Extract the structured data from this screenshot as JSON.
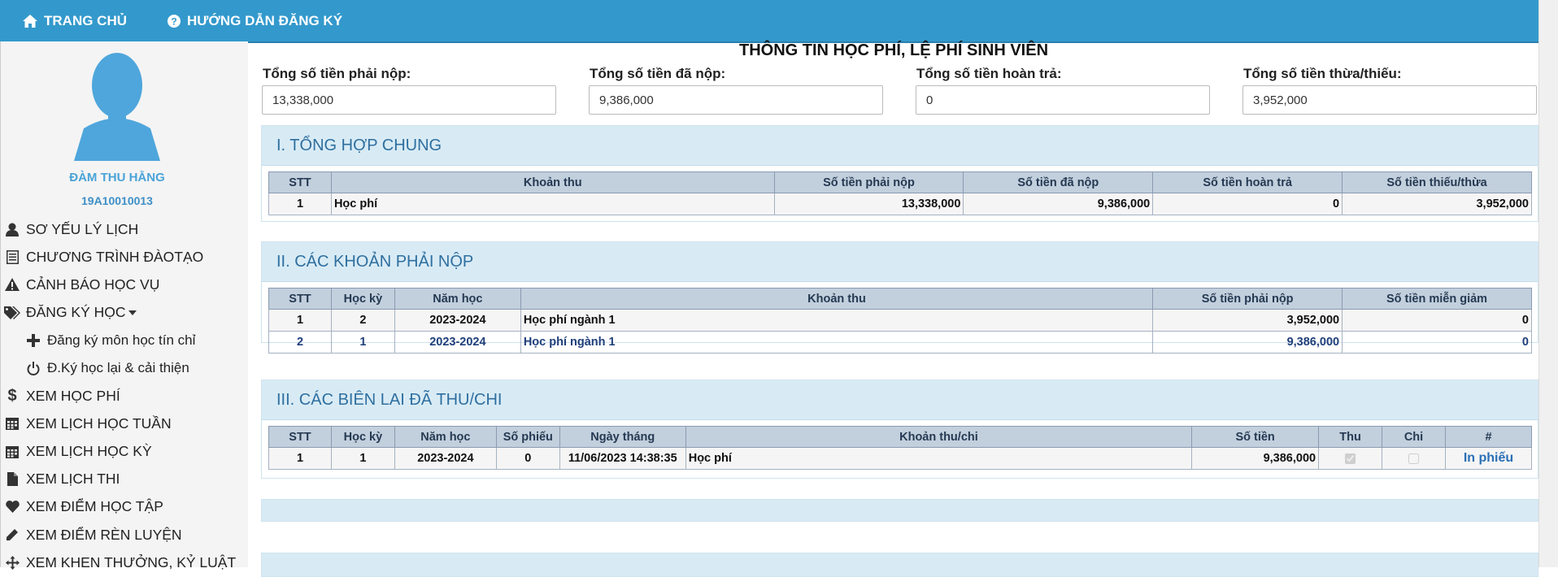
{
  "topnav": {
    "home": "TRANG CHỦ",
    "guide": "HƯỚNG DẪN ĐĂNG KÝ"
  },
  "user": {
    "name": "ĐÀM THU HẰNG",
    "id": "19A10010013"
  },
  "menu": [
    {
      "label": "SƠ YẾU LÝ LỊCH",
      "icon": "user-icon"
    },
    {
      "label": "CHƯƠNG TRÌNH ĐÀOTẠO",
      "icon": "list-icon"
    },
    {
      "label": "CẢNH BÁO HỌC VỤ",
      "icon": "warning-icon"
    },
    {
      "label": "ĐĂNG KÝ HỌC",
      "icon": "tags-icon"
    },
    {
      "label": "Đăng ký môn học tín chỉ",
      "icon": "plus-icon"
    },
    {
      "label": "Đ.Ký học lại & cải thiện",
      "icon": "power-icon"
    },
    {
      "label": "XEM HỌC PHÍ",
      "icon": "dollar-icon"
    },
    {
      "label": "XEM LỊCH HỌC TUẦN",
      "icon": "calendar-icon"
    },
    {
      "label": "XEM LỊCH HỌC KỲ",
      "icon": "calendar-icon"
    },
    {
      "label": "XEM LỊCH THI",
      "icon": "file-icon"
    },
    {
      "label": "XEM ĐIỂM HỌC TẬP",
      "icon": "heart-icon"
    },
    {
      "label": "XEM ĐIỂM RÈN LUYỆN",
      "icon": "pencil-icon"
    },
    {
      "label": "XEM KHEN THƯỞNG, KỶ LUẬT",
      "icon": "move-icon"
    }
  ],
  "page_title": "THÔNG TIN HỌC PHÍ, LỆ PHÍ SINH VIÊN",
  "summary": {
    "due_label": "Tổng số tiền phải nộp:",
    "due_value": "13,338,000",
    "paid_label": "Tổng số tiền đã nộp:",
    "paid_value": "9,386,000",
    "refund_label": "Tổng số tiền hoàn trả:",
    "refund_value": "0",
    "diff_label": "Tổng số tiền thừa/thiếu:",
    "diff_value": "3,952,000"
  },
  "section1": {
    "title": "I. TỔNG HỢP CHUNG",
    "headers": [
      "STT",
      "Khoản thu",
      "Số tiền phải nộp",
      "Số tiền đã nộp",
      "Số tiền hoàn trả",
      "Số tiền thiếu/thừa"
    ],
    "rows": [
      [
        "1",
        "Học phí",
        "13,338,000",
        "9,386,000",
        "0",
        "3,952,000"
      ]
    ]
  },
  "section2": {
    "title": "II. CÁC KHOẢN PHẢI NỘP",
    "headers": [
      "STT",
      "Học kỳ",
      "Năm học",
      "Khoản thu",
      "Số tiền phải nộp",
      "Số tiền miễn giảm"
    ],
    "rows": [
      [
        "1",
        "2",
        "2023-2024",
        "Học phí ngành 1",
        "3,952,000",
        "0"
      ],
      [
        "2",
        "1",
        "2023-2024",
        "Học phí ngành 1",
        "9,386,000",
        "0"
      ]
    ]
  },
  "section3": {
    "title": "III. CÁC BIÊN LAI ĐÃ THU/CHI",
    "headers": [
      "STT",
      "Học kỳ",
      "Năm học",
      "Số phiếu",
      "Ngày tháng",
      "Khoản thu/chi",
      "Số tiền",
      "Thu",
      "Chi",
      "#"
    ],
    "rows": [
      [
        "1",
        "1",
        "2023-2024",
        "0",
        "11/06/2023 14:38:35",
        "Học phí",
        "9,386,000"
      ]
    ],
    "print_label": "In phiếu"
  },
  "colors": {
    "topbar": "#3399cc",
    "panel_header": "#d8ebf5",
    "panel_title": "#2f6f9f",
    "table_header": "#c2cfdd",
    "username": "#4aa3d8"
  }
}
